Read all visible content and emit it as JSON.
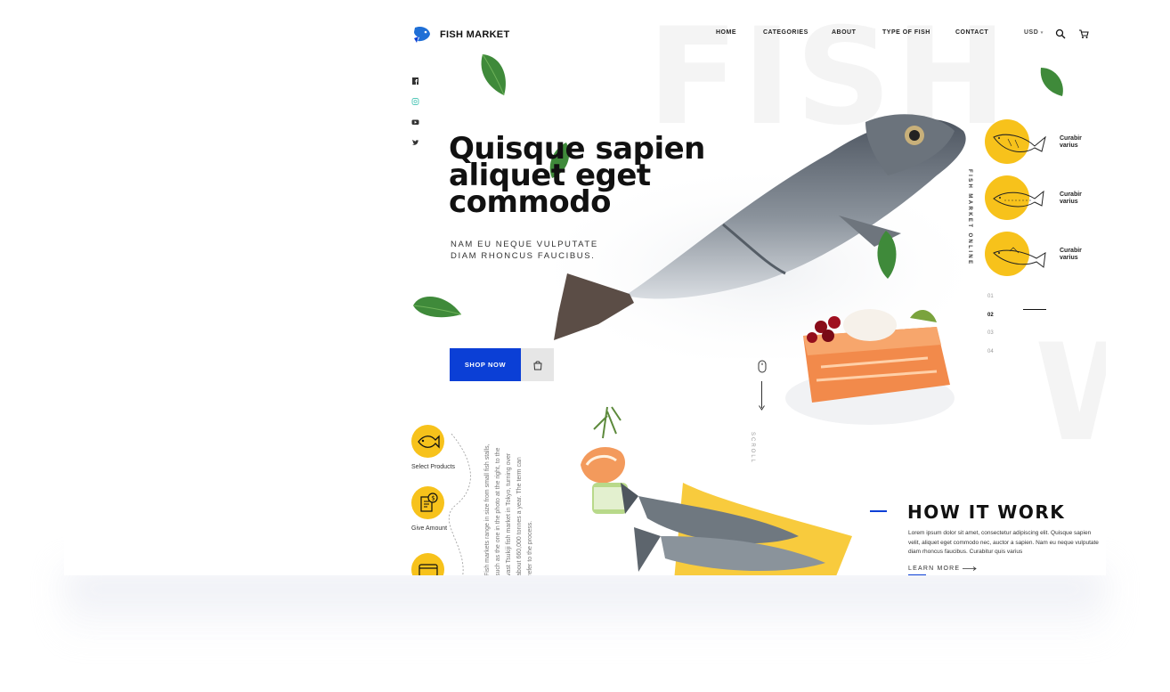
{
  "brand": {
    "name": "FISH MARKET",
    "accent": "#0b3fd6",
    "highlight": "#f7c21b"
  },
  "nav": {
    "items": [
      "HOME",
      "CATEGORIES",
      "ABOUT",
      "TYPE OF FISH",
      "CONTACT"
    ]
  },
  "header": {
    "currency": "USD",
    "search_icon": "search-icon",
    "cart_icon": "cart-icon"
  },
  "social": [
    "facebook-icon",
    "instagram-icon",
    "youtube-icon",
    "twitter-icon"
  ],
  "background_words": {
    "top": "FISH",
    "bottom": "W"
  },
  "hero": {
    "title_lines": [
      "Quisque sapien",
      "aliquet eget",
      "commodo"
    ],
    "subtitle_lines": [
      "NAM EU NEQUE VULPUTATE",
      "DIAM RHONCUS FAUCIBUS."
    ],
    "shop_button": "SHOP NOW"
  },
  "scroll": {
    "label": "SCROLL"
  },
  "side": {
    "vertical_label": "FISH MARKET   ONLINE",
    "items": [
      {
        "label": "Curabir\nvarius"
      },
      {
        "label": "Curabir\nvarius"
      },
      {
        "label": "Curabir\nvarius"
      }
    ],
    "pager": [
      "01",
      "02",
      "03",
      "04"
    ],
    "pager_active": "02"
  },
  "steps": [
    {
      "label": "Select Products",
      "icon": "fish-icon"
    },
    {
      "label": "Give Amount",
      "icon": "invoice-icon"
    },
    {
      "label": "",
      "icon": "payment-card-icon"
    }
  ],
  "steps_paragraph": "Fish markets range in size from small fish stalls, such as the one in the photo at the right, to the vast Tsukiji fish market in Tokyo, turning over about 660,000 tonnes a year. The term can refer to the process.",
  "how_it_work": {
    "title": "HOW IT WORK",
    "text": "Lorem ipsum dolor sit amet, consectetur adipiscing elit. Quisque sapien velit, aliquet eget commodo nec, auctor a sapien. Nam eu neque vulputate diam rhoncus faucibus. Curabitur quis varius",
    "link": "LEARN MORE"
  }
}
